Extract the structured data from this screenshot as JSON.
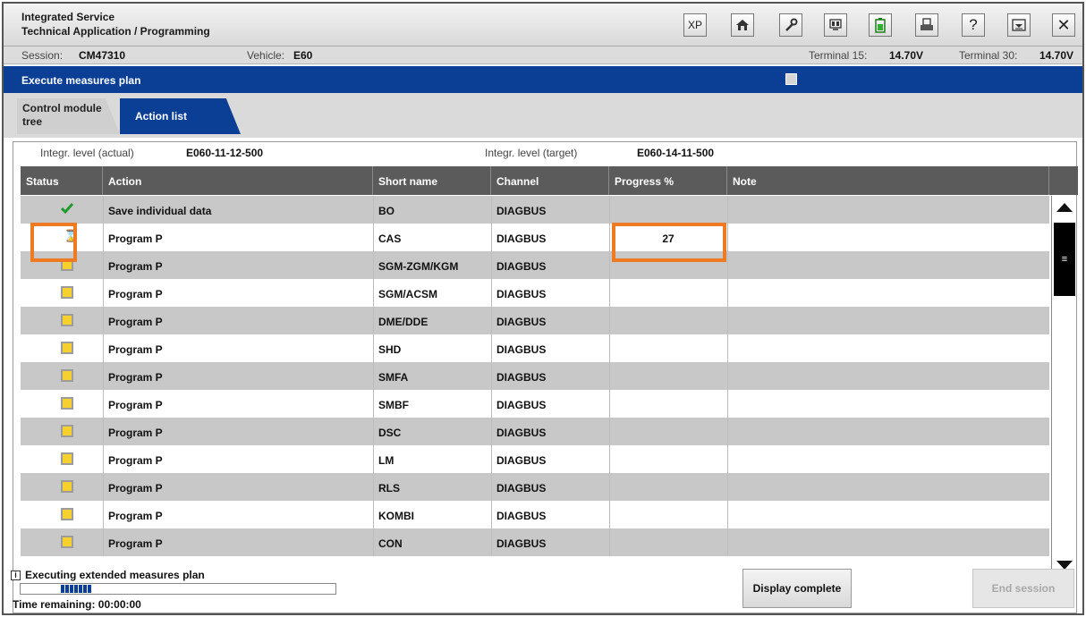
{
  "header": {
    "title_line1": "Integrated Service",
    "title_line2": "Technical Application / Programming",
    "toolbar": [
      {
        "icon": "xp-icon",
        "text": "XP"
      },
      {
        "icon": "home-icon"
      },
      {
        "icon": "wrench-icon"
      },
      {
        "icon": "control-unit-icon"
      },
      {
        "icon": "battery-icon"
      },
      {
        "icon": "print-icon"
      },
      {
        "icon": "help-icon",
        "text": "?"
      },
      {
        "icon": "minimize-window-icon"
      },
      {
        "icon": "close-icon",
        "text": "✕"
      }
    ]
  },
  "session": {
    "session_label": "Session:",
    "session_value": "CM47310",
    "vehicle_label": "Vehicle:",
    "vehicle_value": "E60",
    "terminal15_label": "Terminal 15:",
    "terminal15_value": "14.70V",
    "terminal30_label": "Terminal 30:",
    "terminal30_value": "14.70V"
  },
  "bluebar": {
    "title": "Execute measures plan"
  },
  "tabs": [
    {
      "line1": "Control module",
      "line2": "tree",
      "active": false
    },
    {
      "label": "Action list",
      "active": true
    }
  ],
  "integration": {
    "actual_label": "Integr. level (actual)",
    "actual_value": "E060-11-12-500",
    "target_label": "Integr. level (target)",
    "target_value": "E060-14-11-500"
  },
  "table": {
    "columns": [
      "Status",
      "Action",
      "Short name",
      "Channel",
      "Progress %",
      "Note"
    ],
    "rows": [
      {
        "status": "done",
        "action": "Save individual data",
        "short": "BO",
        "channel": "DIAGBUS",
        "progress": "",
        "note": ""
      },
      {
        "status": "running",
        "action": "Program P",
        "short": "CAS",
        "channel": "DIAGBUS",
        "progress": "27",
        "note": ""
      },
      {
        "status": "pending",
        "action": "Program P",
        "short": "SGM-ZGM/KGM",
        "channel": "DIAGBUS",
        "progress": "",
        "note": ""
      },
      {
        "status": "pending",
        "action": "Program P",
        "short": "SGM/ACSM",
        "channel": "DIAGBUS",
        "progress": "",
        "note": ""
      },
      {
        "status": "pending",
        "action": "Program P",
        "short": "DME/DDE",
        "channel": "DIAGBUS",
        "progress": "",
        "note": ""
      },
      {
        "status": "pending",
        "action": "Program P",
        "short": "SHD",
        "channel": "DIAGBUS",
        "progress": "",
        "note": ""
      },
      {
        "status": "pending",
        "action": "Program P",
        "short": "SMFA",
        "channel": "DIAGBUS",
        "progress": "",
        "note": ""
      },
      {
        "status": "pending",
        "action": "Program P",
        "short": "SMBF",
        "channel": "DIAGBUS",
        "progress": "",
        "note": ""
      },
      {
        "status": "pending",
        "action": "Program P",
        "short": "DSC",
        "channel": "DIAGBUS",
        "progress": "",
        "note": ""
      },
      {
        "status": "pending",
        "action": "Program P",
        "short": "LM",
        "channel": "DIAGBUS",
        "progress": "",
        "note": ""
      },
      {
        "status": "pending",
        "action": "Program P",
        "short": "RLS",
        "channel": "DIAGBUS",
        "progress": "",
        "note": ""
      },
      {
        "status": "pending",
        "action": "Program P",
        "short": "KOMBI",
        "channel": "DIAGBUS",
        "progress": "",
        "note": ""
      },
      {
        "status": "pending",
        "action": "Program P",
        "short": "CON",
        "channel": "DIAGBUS",
        "progress": "",
        "note": ""
      }
    ]
  },
  "footer": {
    "info_icon_text": "i",
    "status_text": "Executing extended measures plan",
    "overall_progress_fraction": 0.08,
    "time_remaining": "Time remaining: 00:00:00",
    "display_complete_label": "Display complete",
    "end_session_label": "End session"
  },
  "colors": {
    "brand_blue": "#0b3f95",
    "highlight_orange": "#ee7a22",
    "pending_yellow": "#f5d02e",
    "done_green": "#1f9a2e",
    "running_blue": "#4f8fd8"
  }
}
